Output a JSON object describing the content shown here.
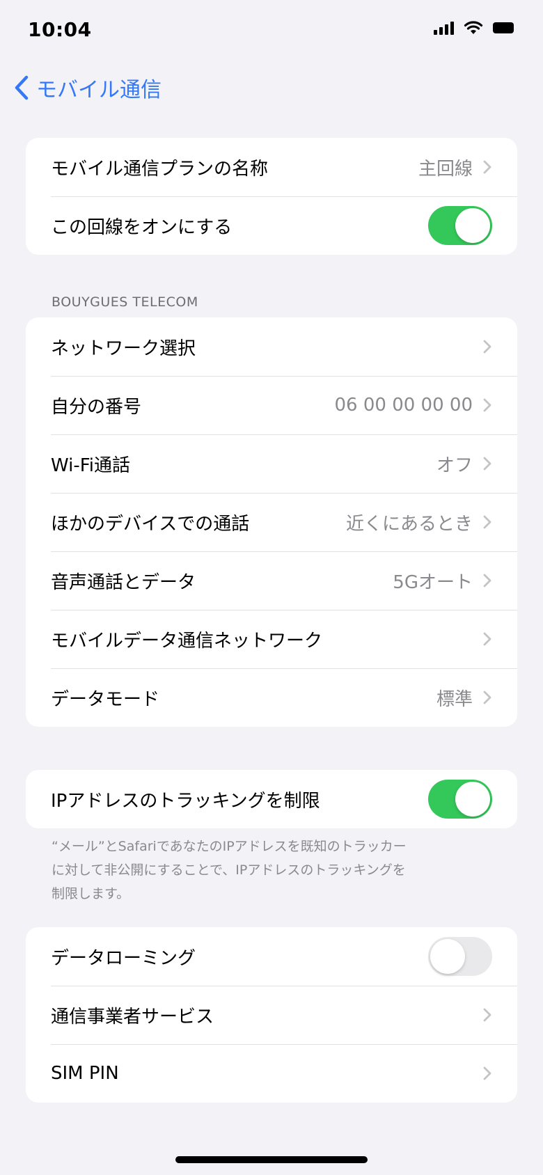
{
  "status_bar": {
    "time": "10:04",
    "icons": [
      "cellular-signal-icon",
      "wifi-icon",
      "battery-icon"
    ]
  },
  "nav": {
    "back_label": "モバイル通信",
    "back_icon": "chevron-left-icon"
  },
  "colors": {
    "accent": "#3478f6",
    "toggle_on": "#34c759",
    "toggle_off": "#e9e9eb",
    "background": "#f2f2f7",
    "secondary_text": "#8a8a8e"
  },
  "group1": {
    "rows": [
      {
        "label": "モバイル通信プランの名称",
        "value": "主回線",
        "accessory": "chevron"
      },
      {
        "label": "この回線をオンにする",
        "accessory": "toggle",
        "toggle_on": true
      }
    ]
  },
  "carrier_section": {
    "header": "BOUYGUES TELECOM",
    "rows": [
      {
        "label": "ネットワーク選択",
        "value": "",
        "accessory": "chevron"
      },
      {
        "label": "自分の番号",
        "value": "06 00 00 00 00",
        "accessory": "chevron"
      },
      {
        "label": "Wi-Fi通話",
        "value": "オフ",
        "accessory": "chevron"
      },
      {
        "label": "ほかのデバイスでの通話",
        "value": "近くにあるとき",
        "accessory": "chevron"
      },
      {
        "label": "音声通話とデータ",
        "value": "5Gオート",
        "accessory": "chevron"
      },
      {
        "label": "モバイルデータ通信ネットワーク",
        "value": "",
        "accessory": "chevron"
      },
      {
        "label": "データモード",
        "value": "標準",
        "accessory": "chevron"
      }
    ]
  },
  "privacy_section": {
    "rows": [
      {
        "label": "IPアドレスのトラッキングを制限",
        "accessory": "toggle",
        "toggle_on": true
      }
    ],
    "footer_lines": [
      "“メール”とSafariであなたのIPアドレスを既知のトラッカー",
      "に対して非公開にすることで、IPアドレスのトラッキングを",
      "制限します。"
    ]
  },
  "group4": {
    "rows": [
      {
        "label": "データローミング",
        "accessory": "toggle",
        "toggle_on": false
      },
      {
        "label": "通信事業者サービス",
        "value": "",
        "accessory": "chevron"
      },
      {
        "label": "SIM PIN",
        "value": "",
        "accessory": "chevron"
      }
    ]
  }
}
